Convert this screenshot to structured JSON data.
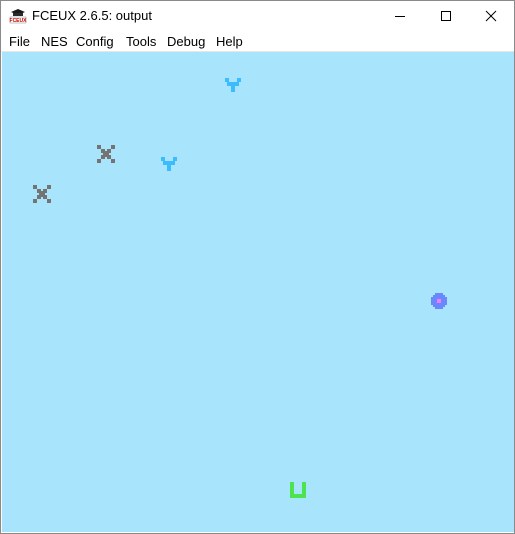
{
  "window": {
    "title": "FCEUX 2.6.5: output",
    "icon": "fceux-app-icon"
  },
  "titlebar_buttons": {
    "minimize": "minimize-icon",
    "maximize": "maximize-icon",
    "close": "close-icon"
  },
  "menu": {
    "items": [
      {
        "label": "File"
      },
      {
        "label": "NES"
      },
      {
        "label": "Config"
      },
      {
        "label": "Tools"
      },
      {
        "label": "Debug"
      },
      {
        "label": "Help"
      }
    ]
  },
  "game": {
    "background_color": "#a8e4fc",
    "sprites": [
      {
        "kind": "y-shape",
        "color": "#3cbcfc"
      },
      {
        "kind": "y-shape",
        "color": "#3cbcfc"
      },
      {
        "kind": "x-shape",
        "color": "#747474"
      },
      {
        "kind": "x-shape",
        "color": "#747474"
      },
      {
        "kind": "circle-target",
        "color": "#6888fc",
        "inner_color": "#f878f8"
      },
      {
        "kind": "u-shape",
        "color": "#4ce44c"
      }
    ]
  }
}
